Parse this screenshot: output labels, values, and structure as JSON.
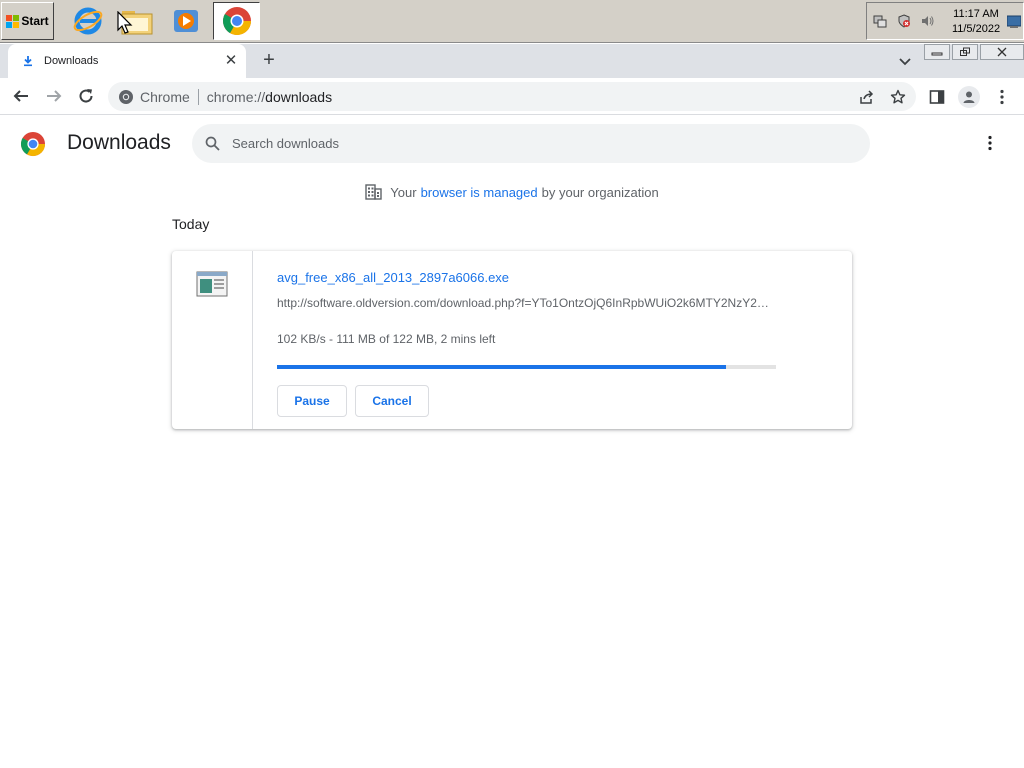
{
  "taskbar": {
    "start_label": "Start",
    "pinned": [
      {
        "name": "internet-explorer",
        "icon": "ie-icon"
      },
      {
        "name": "windows-explorer",
        "icon": "folder-icon"
      },
      {
        "name": "media-player",
        "icon": "media-player-icon"
      },
      {
        "name": "chrome",
        "icon": "chrome-icon",
        "active": true
      }
    ],
    "clock": {
      "time": "11:17 AM",
      "date": "11/5/2022"
    }
  },
  "browser": {
    "tab": {
      "title": "Downloads",
      "icon": "download-icon"
    },
    "omnibox": {
      "site_label": "Chrome",
      "url_scheme": "chrome://",
      "url_host": "downloads"
    }
  },
  "page": {
    "title": "Downloads",
    "search_placeholder": "Search downloads",
    "managed_notice": {
      "prefix": "Your",
      "link": "browser is managed",
      "suffix": "by your organization"
    },
    "section_label": "Today",
    "download": {
      "file_name": "avg_free_x86_all_2013_2897a6066.exe",
      "url": "http://software.oldversion.com/download.php?f=YTo1OntzOjQ6InRpbWUiO2k6MTY2NzY2MjI5Mz",
      "status": "102 KB/s - 111 MB of 122 MB, 2 mins left",
      "progress_fraction": 0.9,
      "buttons": {
        "pause": "Pause",
        "cancel": "Cancel"
      }
    }
  },
  "colors": {
    "accent": "#1a73e8",
    "text": "#202124",
    "secondary": "#5f6368"
  }
}
